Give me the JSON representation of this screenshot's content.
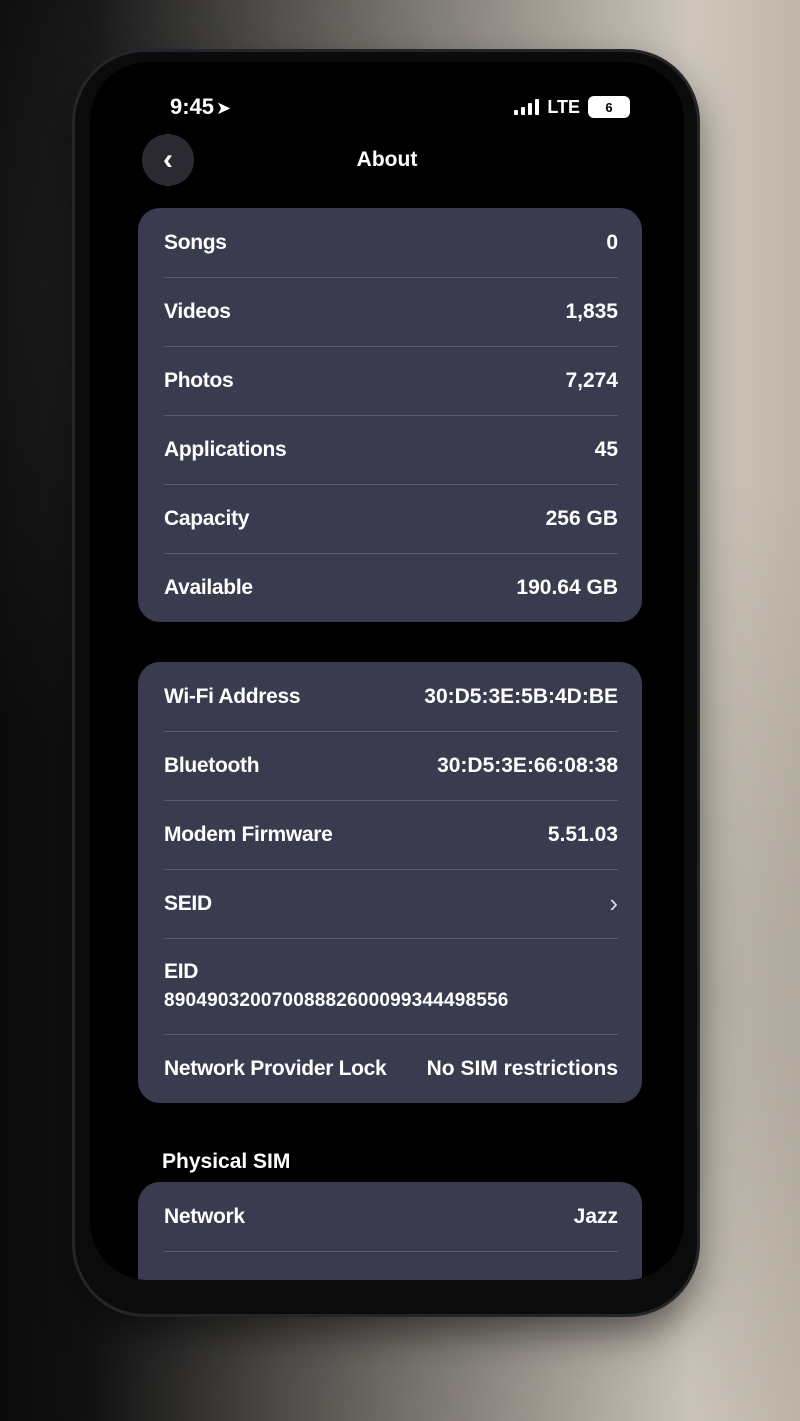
{
  "status_bar": {
    "time": "9:45",
    "network": "LTE",
    "battery": "6"
  },
  "nav": {
    "back_icon": "chevron-left-icon",
    "title": "About"
  },
  "media_card": {
    "rows": [
      {
        "label": "Songs",
        "value": "0"
      },
      {
        "label": "Videos",
        "value": "1,835"
      },
      {
        "label": "Photos",
        "value": "7,274"
      },
      {
        "label": "Applications",
        "value": "45"
      },
      {
        "label": "Capacity",
        "value": "256 GB"
      },
      {
        "label": "Available",
        "value": "190.64 GB"
      }
    ]
  },
  "network_card": {
    "wifi": {
      "label": "Wi-Fi Address",
      "value": "30:D5:3E:5B:4D:BE"
    },
    "bluetooth": {
      "label": "Bluetooth",
      "value": "30:D5:3E:66:08:38"
    },
    "modem": {
      "label": "Modem Firmware",
      "value": "5.51.03"
    },
    "seid": {
      "label": "SEID"
    },
    "eid": {
      "label": "EID",
      "value": "89049032007008882600099344498556"
    },
    "lock": {
      "label": "Network Provider Lock",
      "value": "No SIM restrictions"
    }
  },
  "physical_sim": {
    "header": "Physical SIM",
    "network": {
      "label": "Network",
      "value": "Jazz"
    }
  }
}
